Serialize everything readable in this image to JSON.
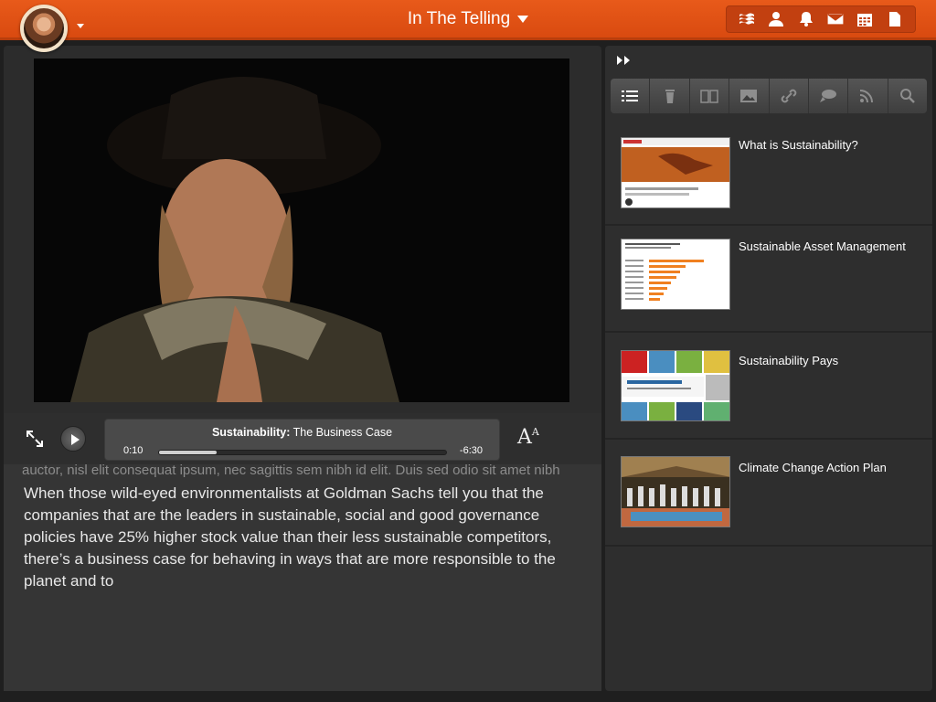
{
  "header": {
    "title": "In The Telling",
    "toolbar": [
      "stream-icon",
      "person-icon",
      "bell-icon",
      "mail-icon",
      "calendar-icon",
      "document-icon"
    ]
  },
  "player": {
    "track_title_bold": "Sustainability:",
    "track_title_rest": " The Business Case",
    "time_current": "0:10",
    "time_remaining": "-6:30",
    "progress_fraction": 0.2
  },
  "transcript": {
    "faded_line": "auctor, nisl elit consequat ipsum, nec sagittis sem nibh id elit. Duis sed odio sit amet nibh",
    "body": "When those wild-eyed environmentalists at Goldman Sachs tell you that the companies that are the leaders in sustainable, social and good governance policies have 25% higher stock value than their less sustainable competitors, there’s a business case for behaving in ways that are more responsible to the planet and to"
  },
  "sidebar": {
    "tabs": [
      "list-icon",
      "trash-icon",
      "book-icon",
      "image-icon",
      "link-icon",
      "chat-icon",
      "rss-icon",
      "search-icon"
    ],
    "active_tab": 0,
    "items": [
      {
        "label": "What is Sustainability?"
      },
      {
        "label": "Sustainable Asset Management"
      },
      {
        "label": "Sustainability Pays"
      },
      {
        "label": "Climate Change Action Plan"
      }
    ]
  },
  "colors": {
    "accent": "#e2531a",
    "panel": "#2c2c2c"
  }
}
